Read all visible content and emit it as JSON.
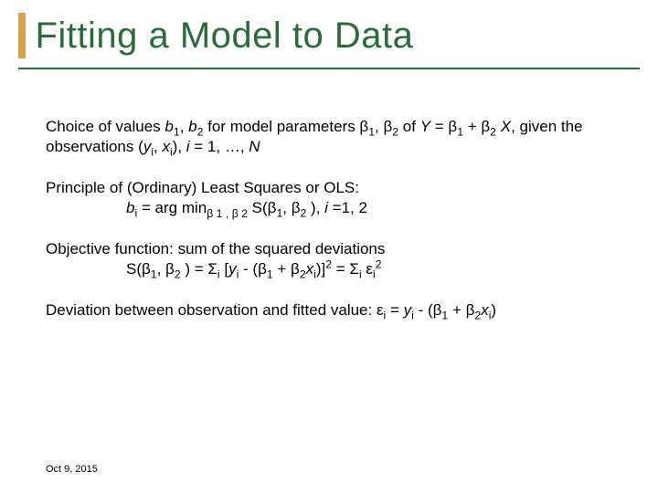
{
  "title": "Fitting a Model to Data",
  "p1a": "Choice of values ",
  "p1_b1": "b",
  "p1_s1": "1",
  "p1b": ", ",
  "p1_b2": "b",
  "p1_s2": "2",
  "p1c": " for model parameters β",
  "p1_s1b": "1",
  "p1d": ", β",
  "p1_s2b": "2",
  "p1e": " of ",
  "p1_Y": "Y",
  "p1f": " = β",
  "p1_s1c": "1",
  "p1g": " + β",
  "p1_s2c": "2",
  "p1h": " ",
  "p1_X": "X",
  "p1i": ", given the observations (",
  "p1_yi_y": "y",
  "p1_yi_i": "i",
  "p1j": ", ",
  "p1_xi_x": "x",
  "p1_xi_i": "i",
  "p1k": "), ",
  "p1_i": "i",
  "p1l": " = 1, …, ",
  "p1_N": "N",
  "p2a": "Principle of (Ordinary) Least Squares or OLS:",
  "p2_bi_b": "b",
  "p2_bi_i": "i",
  "p2b": " = arg min",
  "p2_sub": "β 1 , β 2",
  "p2c": "  S(β",
  "p2_s1": "1",
  "p2d": ", β",
  "p2_s2": "2",
  "p2e": " ), ",
  "p2_i": "i",
  "p2f": " =1, 2",
  "p3a": "Objective function: sum of the squared deviations",
  "p3b": "S(β",
  "p3_s1": "1",
  "p3c": ", β",
  "p3_s2": "2",
  "p3d": " ) = Σ",
  "p3_si1": "i",
  "p3e": " [",
  "p3_yi_y": "y",
  "p3_yi_i": "i",
  "p3f": " - (β",
  "p3_s1b": "1",
  "p3g": " + β",
  "p3_s2b": "2",
  "p3_xib_x": "x",
  "p3_xib_i": "i",
  "p3h": ")]",
  "p3_sq": "2",
  "p3i": " = Σ",
  "p3_si2": "i",
  "p3j": " ε",
  "p3_ei": "i",
  "p3_sq2": "2",
  "p4a": "Deviation between observation and fitted value: ε",
  "p4_ei": "i",
  "p4b": " = ",
  "p4_yi_y": "y",
  "p4_yi_i": "i",
  "p4c": " - (β",
  "p4_s1": "1",
  "p4d": " + β",
  "p4_s2": "2",
  "p4_xi_x": "x",
  "p4_xi_i": "i",
  "p4e": ")",
  "footer": "Oct 9, 2015"
}
